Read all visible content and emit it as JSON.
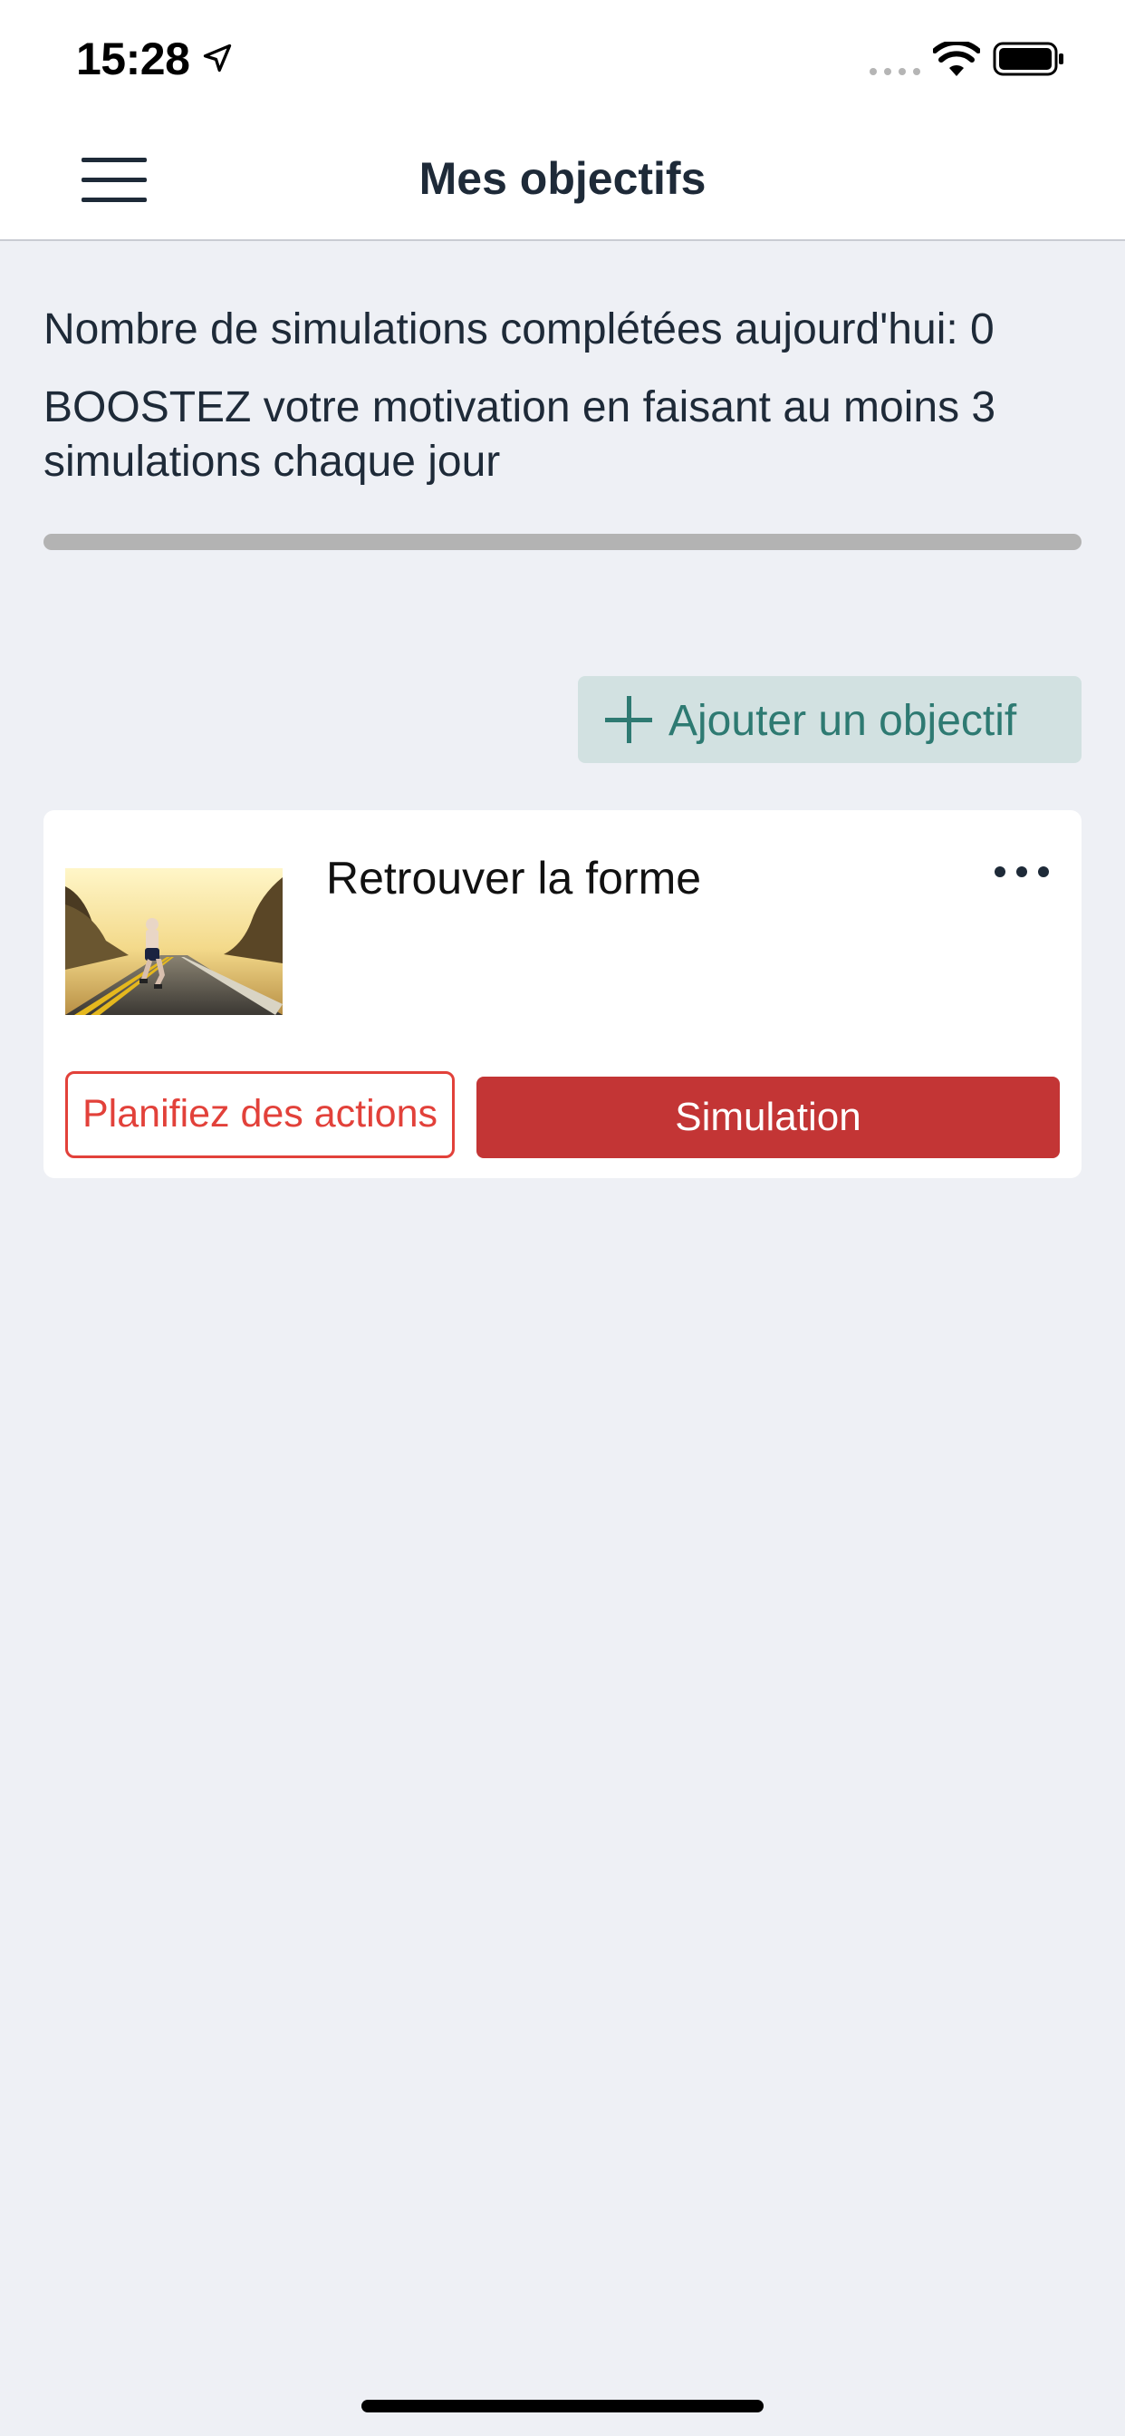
{
  "status_bar": {
    "time": "15:28",
    "icons": [
      "location-arrow-icon",
      "cellular-signal-icon",
      "wifi-icon",
      "battery-icon"
    ]
  },
  "navbar": {
    "title": "Mes objectifs",
    "menu_icon": "hamburger-menu-icon"
  },
  "summary": {
    "count_text": "Nombre de simulations complétées aujourd'hui: 0",
    "boost_text": "BOOSTEZ votre motivation en faisant au moins 3 simulations chaque jour",
    "progress_fraction": 0
  },
  "add_goal": {
    "label": "Ajouter un objectif",
    "icon": "plus-icon"
  },
  "goals": [
    {
      "title": "Retrouver la forme",
      "image": "runner-on-road-photo",
      "more_icon": "more-horizontal-icon",
      "plan_label": "Planifiez des actions",
      "simulation_label": "Simulation"
    }
  ],
  "colors": {
    "accent_red": "#c33535",
    "outline_red": "#e2413a",
    "teal": "#2e7a72",
    "teal_bg": "#d2e1e1",
    "text_dark": "#1e2a38",
    "background": "#eef0f5"
  }
}
